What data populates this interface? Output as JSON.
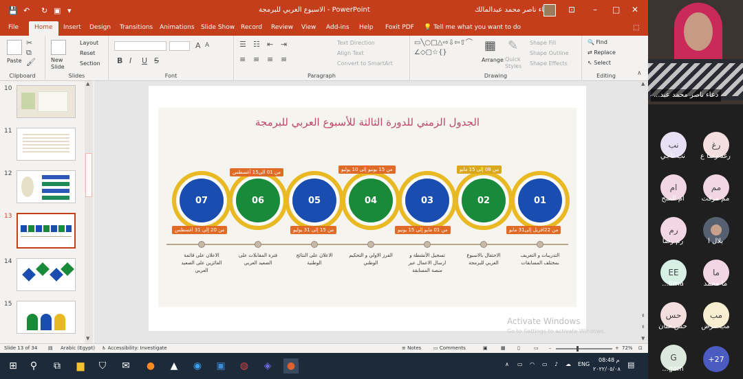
{
  "titlebar": {
    "doc_title": "الاسبوع العربي للبرمجة  -  PowerPoint",
    "user": "دعاء ناصر محمد عبدالمالك",
    "qa_icons": [
      "save-icon",
      "undo-icon",
      "redo-icon",
      "start-from-beginning-icon",
      "customize-icon"
    ],
    "win_controls": [
      "ribbon-display-icon",
      "minimize-icon",
      "maximize-icon",
      "close-icon"
    ]
  },
  "tabs": [
    "File",
    "Home",
    "Insert",
    "Design",
    "Transitions",
    "Animations",
    "Slide Show",
    "Record",
    "Review",
    "View",
    "Add-ins",
    "Help",
    "Foxit PDF"
  ],
  "active_tab": "Home",
  "tellme": "Tell me what you want to do",
  "ribbon": {
    "clipboard": {
      "label": "Clipboard",
      "paste": "Paste"
    },
    "slides": {
      "label": "Slides",
      "new_slide": "New Slide",
      "layout": "Layout",
      "reset": "Reset",
      "section": "Section"
    },
    "font": {
      "label": "Font",
      "bold": "B",
      "italic": "I",
      "underline": "U",
      "strike": "S",
      "grow": "A",
      "shrink": "A"
    },
    "paragraph": {
      "label": "Paragraph",
      "text_direction": "Text Direction",
      "align_text": "Align Text",
      "smartart": "Convert to SmartArt"
    },
    "drawing": {
      "label": "Drawing",
      "arrange": "Arrange",
      "quick_styles": "Quick Styles",
      "shape_fill": "Shape Fill",
      "shape_outline": "Shape Outline",
      "shape_effects": "Shape Effects"
    },
    "editing": {
      "label": "Editing",
      "find": "Find",
      "replace": "Replace",
      "select": "Select"
    }
  },
  "thumbnails": [
    {
      "num": "10"
    },
    {
      "num": "11"
    },
    {
      "num": "12"
    },
    {
      "num": "13",
      "selected": true
    },
    {
      "num": "14"
    },
    {
      "num": "15"
    }
  ],
  "slide": {
    "title": "الجدول الزمني للدورة الثالثة للأسبوع العربي للبرمجة",
    "steps": [
      {
        "num": "07",
        "color": "blue",
        "top_date": "",
        "bottom_date": "من 20 إلى 31 أغسطس",
        "desc": "الاعلان على قائمة الفائزين على الصعيد العربي"
      },
      {
        "num": "06",
        "color": "green",
        "top_date": "من 01 الى15 أغسطس",
        "bottom_date": "",
        "desc": "فترة المقابلات على الصعيد العربي"
      },
      {
        "num": "05",
        "color": "blue",
        "top_date": "",
        "bottom_date": "من 15 إلى 31 يوليو",
        "desc": "الاعلان على النتائج الوطنية"
      },
      {
        "num": "04",
        "color": "green",
        "top_date": "من 15 يونيو إلى 10 يوليو",
        "bottom_date": "",
        "desc": "الفرز الاولي و التحكيم الوطني"
      },
      {
        "num": "03",
        "color": "blue",
        "top_date": "",
        "bottom_date": "من 01 مايو إلى 15 يونيو",
        "desc": "تسجيل الأنشطة و ارسال الاعمال عبر منصة المسابقة"
      },
      {
        "num": "02",
        "color": "green",
        "top_date": "من 08 إلى 15 مايو",
        "bottom_date": "",
        "desc": "الاحتفال بالاسبوع العربي للبرمجة"
      },
      {
        "num": "01",
        "color": "blue",
        "top_date": "",
        "bottom_date": "من 22افريل إلى31 مايو",
        "desc": "التدريبات و التعريف بمختلف المسابقات"
      }
    ]
  },
  "watermark": {
    "line1": "Activate Windows",
    "line2": "Go to Settings to activate Windows."
  },
  "status": {
    "slide": "Slide 13 of 34",
    "language": "Arabic (Egypt)",
    "accessibility": "Accessibility: Investigate",
    "notes": "Notes",
    "comments": "Comments",
    "zoom": "72%"
  },
  "taskbar": {
    "lang": "ENG",
    "time": "08:48 م",
    "date": "٢٠٢٢/٠٥/٠٨"
  },
  "meeting": {
    "presenter": "دعاء ناصر محمد عبد...",
    "participants": [
      {
        "initials": "نب",
        "name": "نب ناجي",
        "bg": "#e8e0f5"
      },
      {
        "initials": "رغ",
        "name": "رغد رضا ع",
        "bg": "#f5dede"
      },
      {
        "initials": "ام",
        "name": "ام السح",
        "bg": "#f3d6e3"
      },
      {
        "initials": "مم",
        "name": "مم مرفت",
        "bg": "#f3d6e3"
      },
      {
        "initials": "رم",
        "name": "رم رضا",
        "bg": "#f3d6e3"
      },
      {
        "initials": "",
        "name": "بلال ا",
        "bg": "#556070"
      },
      {
        "initials": "EE",
        "name": "Ema...",
        "bg": "#d6f0e6"
      },
      {
        "initials": "ما",
        "name": "ما محمد",
        "bg": "#f3d6e3"
      },
      {
        "initials": "حس",
        "name": "حس حنان",
        "bg": "#f5dede"
      },
      {
        "initials": "مب",
        "name": "مب مرض",
        "bg": "#f6eed0"
      },
      {
        "initials": "G",
        "name": "gom...",
        "bg": "#dde8dd"
      }
    ],
    "more": "+27"
  }
}
